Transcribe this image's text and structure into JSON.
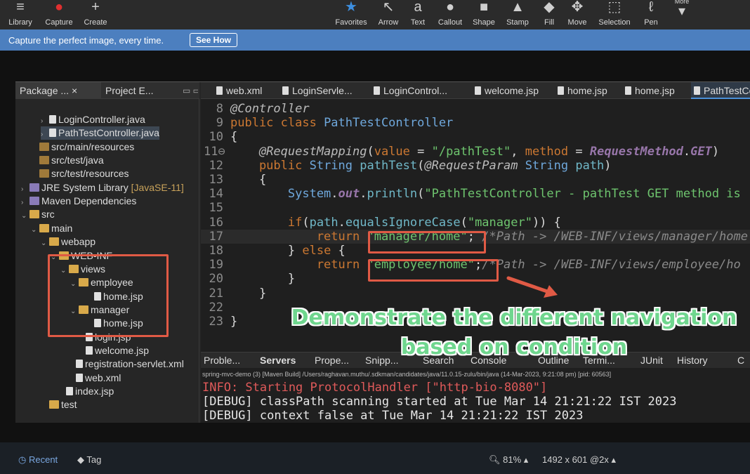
{
  "toolbar": {
    "left": [
      {
        "label": "Library",
        "icon": "≡"
      },
      {
        "label": "Capture",
        "icon": "●"
      },
      {
        "label": "Create",
        "icon": "+"
      }
    ],
    "tools": [
      {
        "label": "Favorites",
        "icon": "★"
      },
      {
        "label": "Arrow",
        "icon": "↖"
      },
      {
        "label": "Text",
        "icon": "a"
      },
      {
        "label": "Callout",
        "icon": "●"
      },
      {
        "label": "Shape",
        "icon": "■"
      },
      {
        "label": "Stamp",
        "icon": "▲"
      },
      {
        "label": "Fill",
        "icon": "◆"
      },
      {
        "label": "Move",
        "icon": "✥"
      },
      {
        "label": "Selection",
        "icon": "⬚"
      },
      {
        "label": "Pen",
        "icon": "ℓ"
      },
      {
        "label": "More",
        "icon": "▾"
      }
    ]
  },
  "banner": {
    "message": "Capture the perfect image, every time.",
    "button": "See How"
  },
  "explorer": {
    "tabs": [
      "Package ...",
      "Project E..."
    ],
    "rows": [
      {
        "text": "LoginController.java",
        "arrow": "›",
        "icon": "jfile"
      },
      {
        "text": "PathTestController.java",
        "arrow": "›",
        "icon": "jfile"
      },
      {
        "text": "src/main/resources",
        "arrow": "",
        "icon": "pkgf"
      },
      {
        "text": "src/test/java",
        "arrow": "",
        "icon": "pkgf"
      },
      {
        "text": "src/test/resources",
        "arrow": "",
        "icon": "pkgf"
      },
      {
        "text": "JRE System Library",
        "tag": "[JavaSE-11]",
        "arrow": "›",
        "icon": "lib"
      },
      {
        "text": "Maven Dependencies",
        "arrow": "›",
        "icon": "lib"
      },
      {
        "text": "src",
        "arrow": "⌄",
        "icon": "folder"
      },
      {
        "text": "main",
        "arrow": "⌄",
        "icon": "folder"
      },
      {
        "text": "webapp",
        "arrow": "⌄",
        "icon": "folder"
      },
      {
        "text": "WEB-INF",
        "arrow": "⌄",
        "icon": "folder"
      },
      {
        "text": "views",
        "arrow": "⌄",
        "icon": "folder"
      },
      {
        "text": "employee",
        "arrow": "⌄",
        "icon": "folder"
      },
      {
        "text": "home.jsp",
        "arrow": "",
        "icon": "jfile"
      },
      {
        "text": "manager",
        "arrow": "⌄",
        "icon": "folder"
      },
      {
        "text": "home.jsp",
        "arrow": "",
        "icon": "jfile"
      },
      {
        "text": "login.jsp",
        "arrow": "",
        "icon": "jfile"
      },
      {
        "text": "welcome.jsp",
        "arrow": "",
        "icon": "jfile"
      },
      {
        "text": "registration-servlet.xml",
        "arrow": "",
        "icon": "jfile"
      },
      {
        "text": "web.xml",
        "arrow": "",
        "icon": "jfile"
      },
      {
        "text": "index.jsp",
        "arrow": "",
        "icon": "jfile"
      },
      {
        "text": "test",
        "arrow": "",
        "icon": "folder"
      }
    ]
  },
  "editor": {
    "tabs": [
      "web.xml",
      "LoginServle...",
      "LoginControl...",
      "welcome.jsp",
      "home.jsp",
      "home.jsp",
      "PathTestCon"
    ],
    "lines": [
      {
        "n": "8",
        "tokens": [
          [
            "ann",
            "@Controller"
          ]
        ]
      },
      {
        "n": "9",
        "tokens": [
          [
            "kw",
            "public class "
          ],
          [
            "ty",
            "PathTestController"
          ]
        ]
      },
      {
        "n": "10",
        "tokens": [
          [
            "",
            "{"
          ]
        ]
      },
      {
        "n": "11⊖",
        "tokens": [
          [
            "ann",
            "    @RequestMapping"
          ],
          [
            "",
            "("
          ],
          [
            "kw",
            "value"
          ],
          [
            "",
            " = "
          ],
          [
            "st",
            "\"/pathTest\""
          ],
          [
            "",
            ", "
          ],
          [
            "kw",
            "method"
          ],
          [
            "",
            " = "
          ],
          [
            "fld",
            "RequestMethod"
          ],
          [
            "",
            "."
          ],
          [
            "fld",
            "GET"
          ],
          [
            "",
            ")"
          ]
        ]
      },
      {
        "n": "12",
        "tokens": [
          [
            "kw",
            "    public "
          ],
          [
            "ty",
            "String "
          ],
          [
            "mt",
            "pathTest"
          ],
          [
            "",
            "("
          ],
          [
            "ann",
            "@RequestParam "
          ],
          [
            "ty",
            "String "
          ],
          [
            "mt",
            "path"
          ],
          [
            "",
            ")"
          ]
        ]
      },
      {
        "n": "13",
        "tokens": [
          [
            "",
            "    {"
          ]
        ]
      },
      {
        "n": "14",
        "tokens": [
          [
            "ty",
            "        System"
          ],
          [
            "",
            "."
          ],
          [
            "fld",
            "out"
          ],
          [
            "",
            "."
          ],
          [
            "mt",
            "println"
          ],
          [
            "",
            "("
          ],
          [
            "st",
            "\"PathTestController - pathTest GET method is"
          ]
        ]
      },
      {
        "n": "15",
        "tokens": [
          [
            "",
            ""
          ]
        ]
      },
      {
        "n": "16",
        "tokens": [
          [
            "kw",
            "        if"
          ],
          [
            "",
            "("
          ],
          [
            "mt",
            "path"
          ],
          [
            "",
            "."
          ],
          [
            "mt",
            "equalsIgnoreCase"
          ],
          [
            "",
            "("
          ],
          [
            "st",
            "\"manager\""
          ],
          [
            "",
            ")) {"
          ]
        ]
      },
      {
        "n": "17",
        "tokens": [
          [
            "kw",
            "            return "
          ],
          [
            "st",
            "\"manager/home\""
          ],
          [
            "",
            "; "
          ],
          [
            "cm",
            "/*Path -> /WEB-INF/views/manager/home"
          ]
        ]
      },
      {
        "n": "18",
        "tokens": [
          [
            "",
            "        } "
          ],
          [
            "kw",
            "else"
          ],
          [
            "",
            " {"
          ]
        ]
      },
      {
        "n": "19",
        "tokens": [
          [
            "kw",
            "            return "
          ],
          [
            "st",
            "\"employee/home\""
          ],
          [
            "",
            ";"
          ],
          [
            "cm",
            "/*Path -> /WEB-INF/views/employee/ho"
          ]
        ]
      },
      {
        "n": "20",
        "tokens": [
          [
            "",
            "        }"
          ]
        ]
      },
      {
        "n": "21",
        "tokens": [
          [
            "",
            "    }"
          ]
        ]
      },
      {
        "n": "22",
        "tokens": [
          [
            "",
            ""
          ]
        ]
      },
      {
        "n": "23",
        "tokens": [
          [
            "",
            "}"
          ]
        ]
      }
    ]
  },
  "bottom": {
    "tabs": [
      "Proble...",
      "Servers",
      "Prope...",
      "Snipp...",
      "Search",
      "Console",
      "Outline",
      "Termi...",
      "JUnit",
      "History",
      "C"
    ],
    "console_header": "spring-mvc-demo (3) [Maven Build] /Users/raghavan.muthu/.sdkman/candidates/java/11.0.15-zulu/bin/java  (14-Mar-2023, 9:21:08 pm) [pid: 60563]",
    "lines": [
      {
        "text": "INFO: Starting ProtocolHandler [\"http-bio-8080\"]",
        "color": "#e05a5a"
      },
      {
        "text": "[DEBUG] classPath scanning started at Tue Mar 14 21:21:22 IST 2023",
        "color": "#e6e6e6"
      },
      {
        "text": "[DEBUG] context false at Tue Mar 14 21:21:22 IST 2023",
        "color": "#e6e6e6"
      }
    ]
  },
  "annotation": {
    "caption_line1": "Demonstrate the different navigation",
    "caption_line2": "based on condition",
    "box_color": "#e05a45",
    "caption_color": "#6fd68e"
  },
  "status": {
    "recent": "Recent",
    "tag": "Tag",
    "zoom": "81% ▴",
    "dims": "1492 x 601 @2x ▴"
  }
}
